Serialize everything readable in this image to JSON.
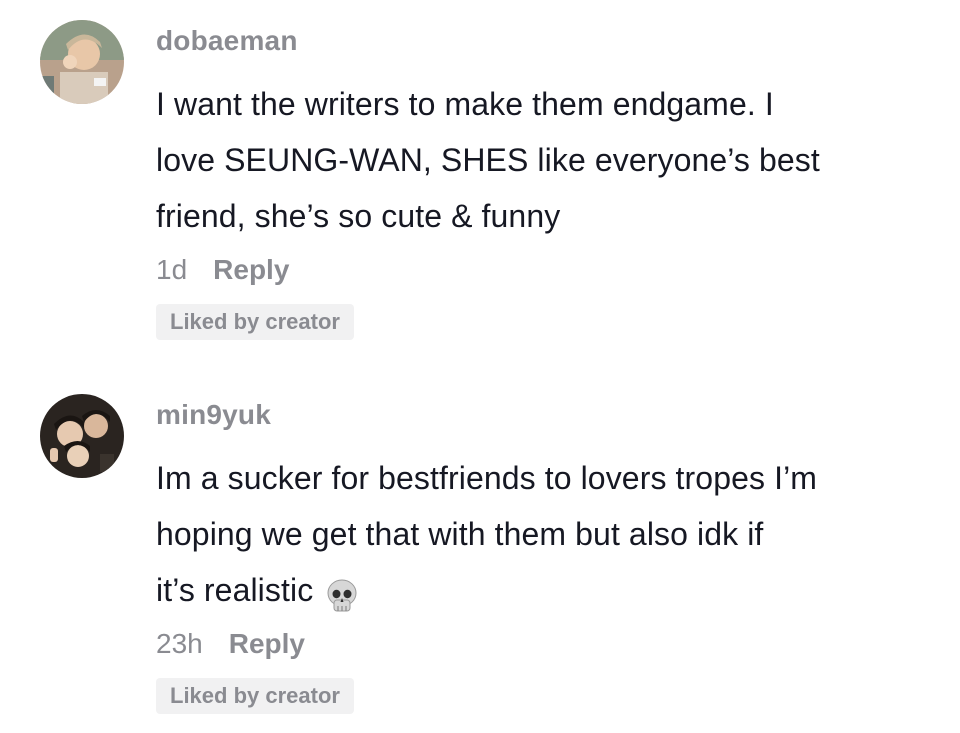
{
  "comments": [
    {
      "username": "dobaeman",
      "text_lines": [
        "I want the writers to make them endgame. I",
        "love SEUNG-WAN, SHES like everyone’s best",
        "friend, she’s so cute & funny"
      ],
      "time": "1d",
      "reply_label": "Reply",
      "badge": "Liked by creator",
      "avatar_icon": "user-avatar-photo"
    },
    {
      "username": "min9yuk",
      "text_lines": [
        "Im a sucker for bestfriends to lovers tropes I’m",
        "hoping we get that with them but also idk if",
        "it’s realistic"
      ],
      "emoji": "skull-emoji",
      "time": "23h",
      "reply_label": "Reply",
      "badge": "Liked by creator",
      "avatar_icon": "user-avatar-photo"
    }
  ],
  "colors": {
    "username": "#8a8b91",
    "text": "#161823",
    "badge_bg": "#f1f1f2"
  }
}
